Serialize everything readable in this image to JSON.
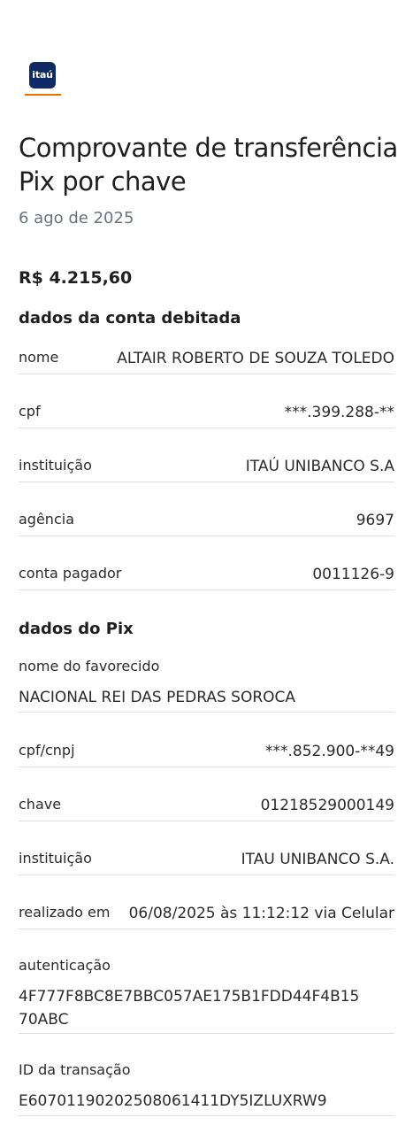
{
  "brand": {
    "logo_text": "itaú"
  },
  "header": {
    "title": "Comprovante de transferência Pix por chave",
    "date": "6 ago de 2025"
  },
  "amount": "R$ 4.215,60",
  "debited_account": {
    "section_title": "dados da conta debitada",
    "rows": [
      {
        "label": "nome",
        "value": "ALTAIR ROBERTO DE SOUZA TOLEDO"
      },
      {
        "label": "cpf",
        "value": "***.399.288-**"
      },
      {
        "label": "instituição",
        "value": "ITAÚ UNIBANCO S.A"
      },
      {
        "label": "agência",
        "value": "9697"
      },
      {
        "label": "conta pagador",
        "value": "0011126-9"
      }
    ]
  },
  "pix": {
    "section_title": "dados do Pix",
    "recipient_label": "nome do favorecido",
    "recipient_value": "NACIONAL REI DAS PEDRAS SOROCA",
    "rows": [
      {
        "label": "cpf/cnpj",
        "value": "***.852.900-**49"
      },
      {
        "label": "chave",
        "value": "01218529000149"
      },
      {
        "label": "instituição",
        "value": "ITAU UNIBANCO S.A."
      },
      {
        "label": "realizado em",
        "value": "06/08/2025 às 11:12:12 via Celular"
      }
    ],
    "auth_label": "autenticação",
    "auth_value": "4F777F8BC8E7BBC057AE175B1FDD44F4B15\n70ABC",
    "transaction_label": "ID da transação",
    "transaction_value": "E60701190202508061411DY5IZLUXRW9"
  }
}
